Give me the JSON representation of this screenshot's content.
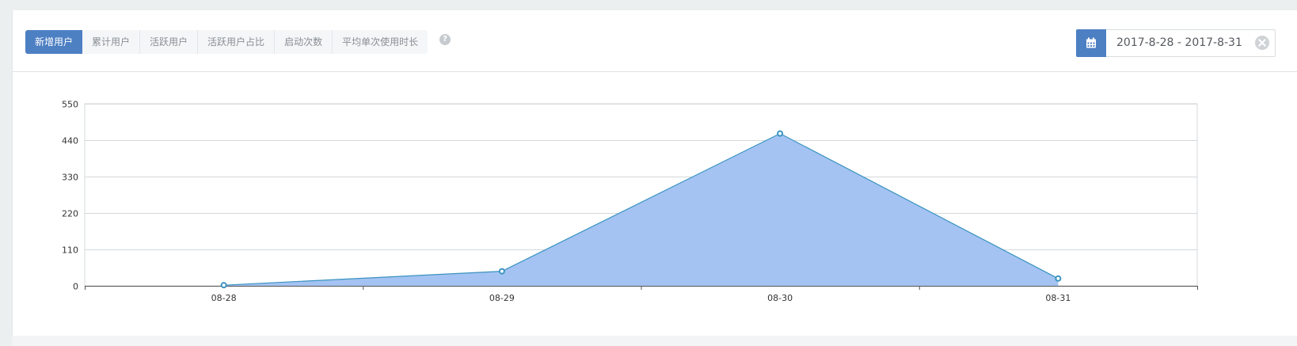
{
  "tabs": [
    {
      "label": "新增用户",
      "active": true
    },
    {
      "label": "累计用户",
      "active": false
    },
    {
      "label": "活跃用户",
      "active": false
    },
    {
      "label": "活跃用户占比",
      "active": false
    },
    {
      "label": "启动次数",
      "active": false
    },
    {
      "label": "平均单次使用时长",
      "active": false
    }
  ],
  "help": {
    "icon": "question-circle-icon",
    "glyph": "?"
  },
  "date_range": {
    "value": "2017-8-28 - 2017-8-31",
    "icon": "calendar-icon",
    "clear_icon": "clear-icon"
  },
  "colors": {
    "accent": "#4d7fc3",
    "area_fill": "#a4c3f2",
    "line": "#3a93c0"
  },
  "chart_data": {
    "type": "area",
    "categories": [
      "08-28",
      "08-29",
      "08-30",
      "08-31"
    ],
    "values": [
      2,
      44,
      460,
      22
    ],
    "y_ticks": [
      "0",
      "110",
      "220",
      "330",
      "440",
      "550"
    ],
    "ylim": [
      0,
      550
    ],
    "grid": true
  }
}
